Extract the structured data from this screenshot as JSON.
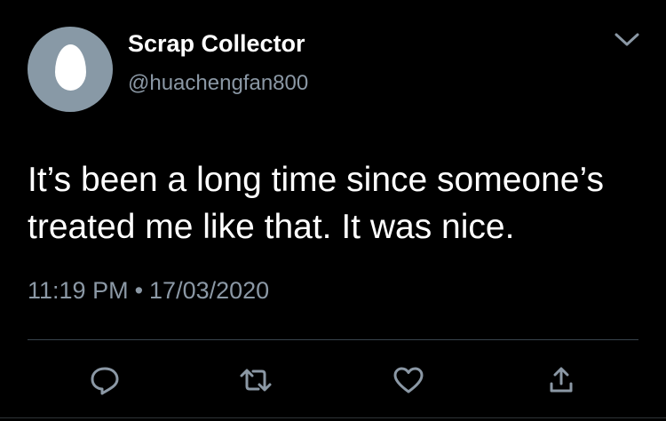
{
  "user": {
    "display_name": "Scrap Collector",
    "handle": "@huachengfan800",
    "avatar_icon": "default-egg-avatar"
  },
  "tweet": {
    "text_lines": [
      "It’s been a long time since someone’s",
      "treated me like that. It was nice."
    ],
    "time": "11:19 PM",
    "separator": "•",
    "date": "17/03/2020"
  },
  "actions": {
    "reply_icon": "reply-icon",
    "retweet_icon": "retweet-icon",
    "like_icon": "heart-icon",
    "share_icon": "share-icon"
  },
  "colors": {
    "background": "#000000",
    "primary_text": "#ffffff",
    "secondary_text": "#8b98a5",
    "avatar_bg": "#8899a6",
    "divider": "#38444d"
  }
}
